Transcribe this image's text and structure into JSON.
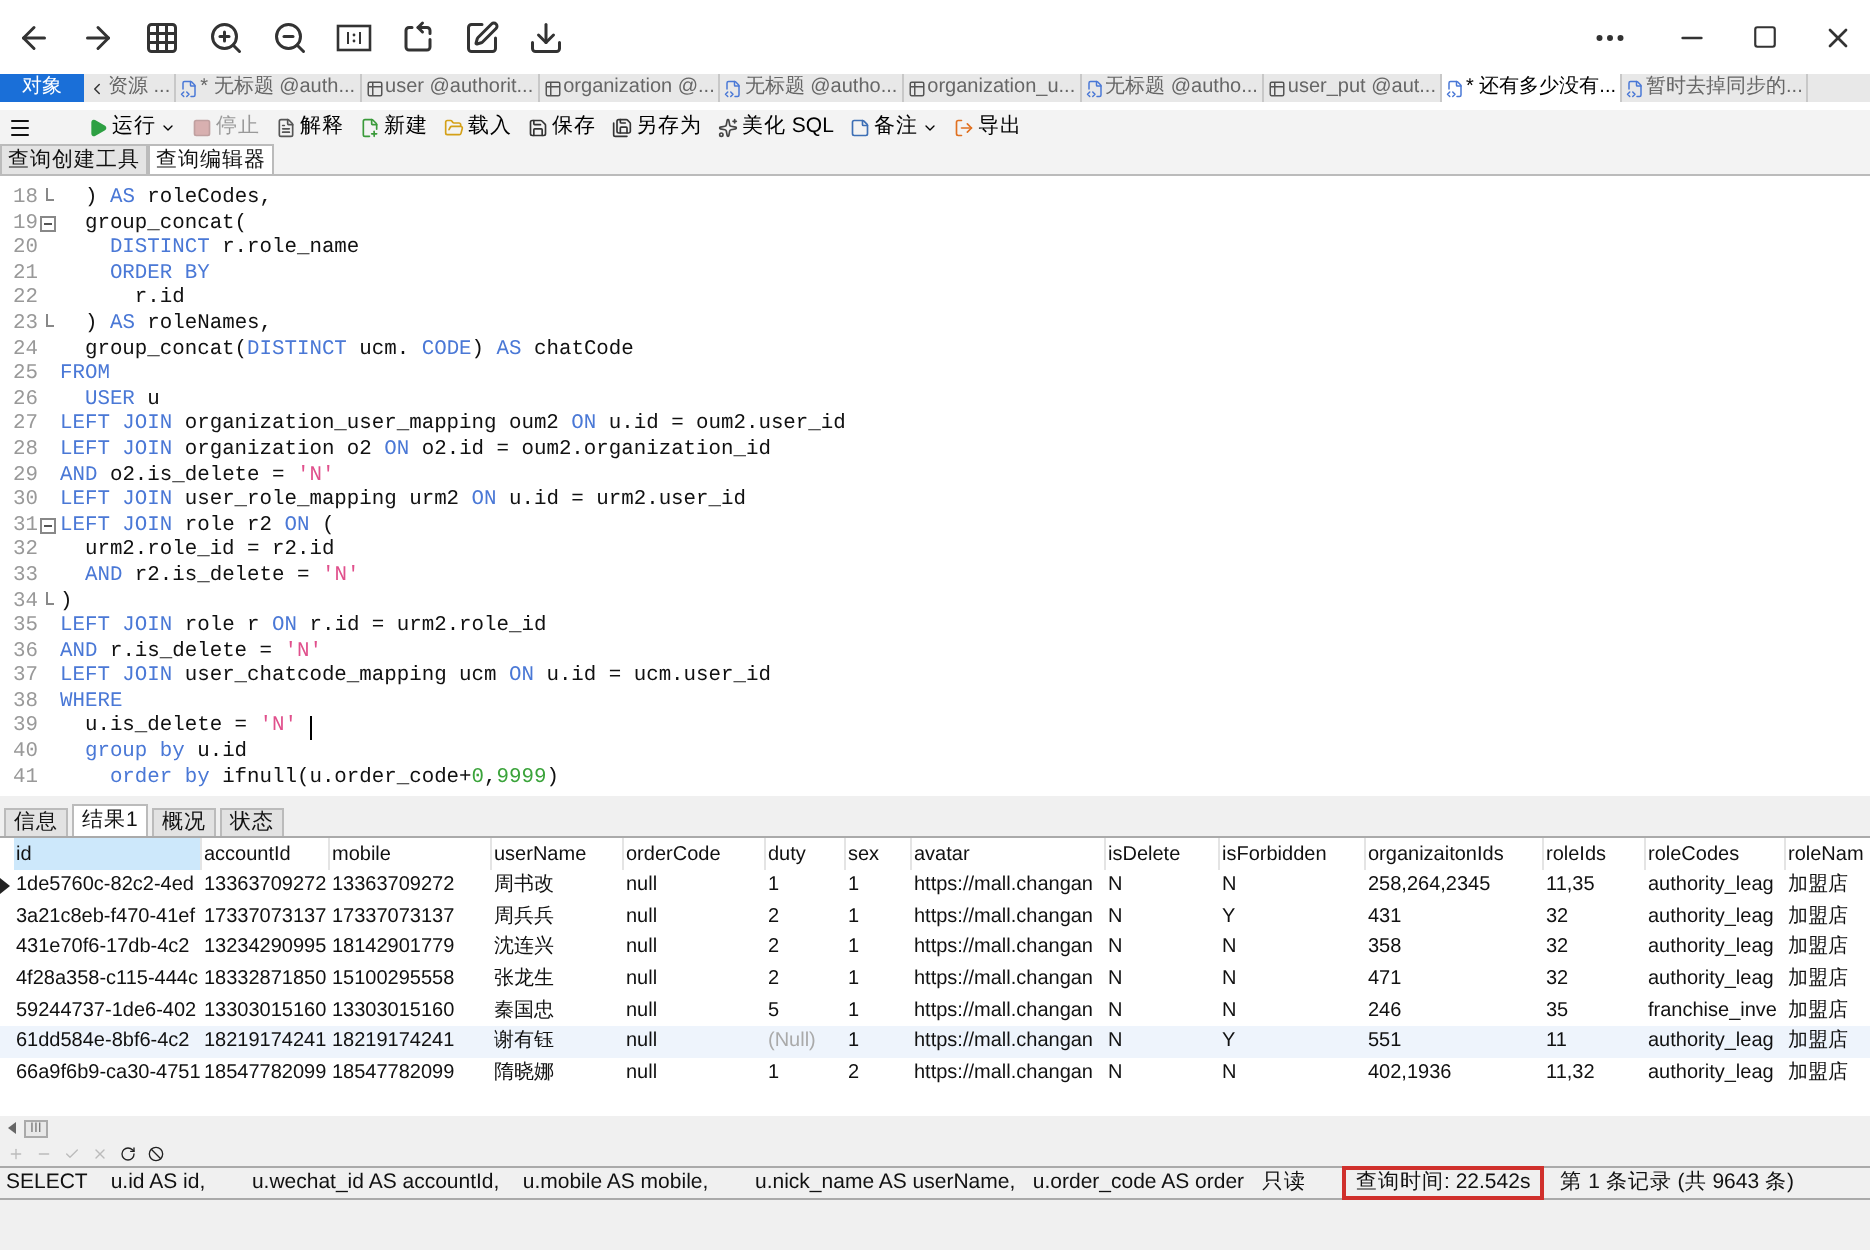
{
  "object_tab": "对象",
  "doc_tabs": [
    {
      "label": "资源 ...",
      "kind": "nav",
      "selected": false
    },
    {
      "label": "* 无标题 @auth...",
      "kind": "query",
      "selected": false
    },
    {
      "label": "user @authorit...",
      "kind": "table",
      "selected": false
    },
    {
      "label": "organization @...",
      "kind": "table",
      "selected": false
    },
    {
      "label": "无标题 @autho...",
      "kind": "query",
      "selected": false
    },
    {
      "label": "organization_u...",
      "kind": "table",
      "selected": false
    },
    {
      "label": "无标题 @autho...",
      "kind": "query",
      "selected": false
    },
    {
      "label": "user_put @aut...",
      "kind": "table",
      "selected": false
    },
    {
      "label": "* 还有多少没有...",
      "kind": "query",
      "selected": true
    },
    {
      "label": "暂时去掉同步的...",
      "kind": "query",
      "selected": false
    }
  ],
  "toolbar": [
    {
      "label": "运行",
      "kind": "run",
      "dropdown": true,
      "disabled": false
    },
    {
      "label": "停止",
      "kind": "stop",
      "dropdown": false,
      "disabled": true
    },
    {
      "label": "解释",
      "kind": "explain",
      "dropdown": false,
      "disabled": false
    },
    {
      "label": "新建",
      "kind": "new",
      "dropdown": false,
      "disabled": false
    },
    {
      "label": "载入",
      "kind": "load",
      "dropdown": false,
      "disabled": false
    },
    {
      "label": "保存",
      "kind": "save",
      "dropdown": false,
      "disabled": false
    },
    {
      "label": "另存为",
      "kind": "saveas",
      "dropdown": false,
      "disabled": false
    },
    {
      "label": "美化 SQL",
      "kind": "beautify",
      "dropdown": false,
      "disabled": false
    },
    {
      "label": "备注",
      "kind": "note",
      "dropdown": true,
      "disabled": false
    },
    {
      "label": "导出",
      "kind": "export",
      "dropdown": false,
      "disabled": false
    }
  ],
  "editor_tabs": [
    {
      "label": "查询创建工具",
      "selected": false
    },
    {
      "label": "查询编辑器",
      "selected": true
    }
  ],
  "code": [
    {
      "num": "18",
      "fold_start": false,
      "fold_end": true,
      "tokens": [
        {
          "text": "  ) ",
          "kind": "plain"
        },
        {
          "text": "AS",
          "kind": "keyword"
        },
        {
          "text": " roleCodes,",
          "kind": "plain"
        }
      ]
    },
    {
      "num": "19",
      "fold_start": true,
      "fold_end": false,
      "tokens": [
        {
          "text": "  group_concat(",
          "kind": "plain"
        }
      ]
    },
    {
      "num": "20",
      "fold_start": false,
      "fold_end": false,
      "tokens": [
        {
          "text": "    DISTINCT",
          "kind": "keyword"
        },
        {
          "text": " r.role_name",
          "kind": "plain"
        }
      ]
    },
    {
      "num": "21",
      "fold_start": false,
      "fold_end": false,
      "tokens": [
        {
          "text": "    ORDER BY",
          "kind": "keyword"
        }
      ]
    },
    {
      "num": "22",
      "fold_start": false,
      "fold_end": false,
      "tokens": [
        {
          "text": "      r.id",
          "kind": "plain"
        }
      ]
    },
    {
      "num": "23",
      "fold_start": false,
      "fold_end": true,
      "tokens": [
        {
          "text": "  ) ",
          "kind": "plain"
        },
        {
          "text": "AS",
          "kind": "keyword"
        },
        {
          "text": " roleNames,",
          "kind": "plain"
        }
      ]
    },
    {
      "num": "24",
      "fold_start": false,
      "fold_end": false,
      "tokens": [
        {
          "text": "  group_concat(",
          "kind": "plain"
        },
        {
          "text": "DISTINCT",
          "kind": "keyword"
        },
        {
          "text": " ucm. ",
          "kind": "plain"
        },
        {
          "text": "CODE",
          "kind": "keyword"
        },
        {
          "text": ") ",
          "kind": "plain"
        },
        {
          "text": "AS",
          "kind": "keyword"
        },
        {
          "text": " chatCode",
          "kind": "plain"
        }
      ]
    },
    {
      "num": "25",
      "fold_start": false,
      "fold_end": false,
      "tokens": [
        {
          "text": "FROM",
          "kind": "keyword"
        }
      ]
    },
    {
      "num": "26",
      "fold_start": false,
      "fold_end": false,
      "tokens": [
        {
          "text": "  USER",
          "kind": "keyword"
        },
        {
          "text": " u",
          "kind": "plain"
        }
      ]
    },
    {
      "num": "27",
      "fold_start": false,
      "fold_end": false,
      "tokens": [
        {
          "text": "LEFT JOIN",
          "kind": "keyword"
        },
        {
          "text": " organization_user_mapping oum2 ",
          "kind": "plain"
        },
        {
          "text": "ON",
          "kind": "keyword"
        },
        {
          "text": " u.id = oum2.user_id",
          "kind": "plain"
        }
      ]
    },
    {
      "num": "28",
      "fold_start": false,
      "fold_end": false,
      "tokens": [
        {
          "text": "LEFT JOIN",
          "kind": "keyword"
        },
        {
          "text": " organization o2 ",
          "kind": "plain"
        },
        {
          "text": "ON",
          "kind": "keyword"
        },
        {
          "text": " o2.id = oum2.organization_id",
          "kind": "plain"
        }
      ]
    },
    {
      "num": "29",
      "fold_start": false,
      "fold_end": false,
      "tokens": [
        {
          "text": "AND",
          "kind": "keyword"
        },
        {
          "text": " o2.is_delete = ",
          "kind": "plain"
        },
        {
          "text": "'N'",
          "kind": "string"
        }
      ]
    },
    {
      "num": "30",
      "fold_start": false,
      "fold_end": false,
      "tokens": [
        {
          "text": "LEFT JOIN",
          "kind": "keyword"
        },
        {
          "text": " user_role_mapping urm2 ",
          "kind": "plain"
        },
        {
          "text": "ON",
          "kind": "keyword"
        },
        {
          "text": " u.id = urm2.user_id",
          "kind": "plain"
        }
      ]
    },
    {
      "num": "31",
      "fold_start": true,
      "fold_end": false,
      "tokens": [
        {
          "text": "LEFT JOIN",
          "kind": "keyword"
        },
        {
          "text": " role r2 ",
          "kind": "plain"
        },
        {
          "text": "ON",
          "kind": "keyword"
        },
        {
          "text": " (",
          "kind": "plain"
        }
      ]
    },
    {
      "num": "32",
      "fold_start": false,
      "fold_end": false,
      "tokens": [
        {
          "text": "  urm2.role_id = r2.id",
          "kind": "plain"
        }
      ]
    },
    {
      "num": "33",
      "fold_start": false,
      "fold_end": false,
      "tokens": [
        {
          "text": "  AND",
          "kind": "keyword"
        },
        {
          "text": " r2.is_delete = ",
          "kind": "plain"
        },
        {
          "text": "'N'",
          "kind": "string"
        }
      ]
    },
    {
      "num": "34",
      "fold_start": false,
      "fold_end": true,
      "tokens": [
        {
          "text": ")",
          "kind": "plain"
        }
      ]
    },
    {
      "num": "35",
      "fold_start": false,
      "fold_end": false,
      "tokens": [
        {
          "text": "LEFT JOIN",
          "kind": "keyword"
        },
        {
          "text": " role r ",
          "kind": "plain"
        },
        {
          "text": "ON",
          "kind": "keyword"
        },
        {
          "text": " r.id = urm2.role_id",
          "kind": "plain"
        }
      ]
    },
    {
      "num": "36",
      "fold_start": false,
      "fold_end": false,
      "tokens": [
        {
          "text": "AND",
          "kind": "keyword"
        },
        {
          "text": " r.is_delete = ",
          "kind": "plain"
        },
        {
          "text": "'N'",
          "kind": "string"
        }
      ]
    },
    {
      "num": "37",
      "fold_start": false,
      "fold_end": false,
      "tokens": [
        {
          "text": "LEFT JOIN",
          "kind": "keyword"
        },
        {
          "text": " user_chatcode_mapping ucm ",
          "kind": "plain"
        },
        {
          "text": "ON",
          "kind": "keyword"
        },
        {
          "text": " u.id = ucm.user_id",
          "kind": "plain"
        }
      ]
    },
    {
      "num": "38",
      "fold_start": false,
      "fold_end": false,
      "tokens": [
        {
          "text": "WHERE",
          "kind": "keyword"
        }
      ]
    },
    {
      "num": "39",
      "fold_start": false,
      "fold_end": false,
      "cursor": true,
      "tokens": [
        {
          "text": "  u.is_delete = ",
          "kind": "plain"
        },
        {
          "text": "'N'",
          "kind": "string"
        }
      ]
    },
    {
      "num": "40",
      "fold_start": false,
      "fold_end": false,
      "tokens": [
        {
          "text": "  group by",
          "kind": "keyword"
        },
        {
          "text": " u.id",
          "kind": "plain"
        }
      ]
    },
    {
      "num": "41",
      "fold_start": false,
      "fold_end": false,
      "tokens": [
        {
          "text": "    order by",
          "kind": "keyword"
        },
        {
          "text": " ifnull(u.order_code+",
          "kind": "plain"
        },
        {
          "text": "0",
          "kind": "number"
        },
        {
          "text": ",",
          "kind": "plain"
        },
        {
          "text": "9999",
          "kind": "number"
        },
        {
          "text": ")",
          "kind": "plain"
        }
      ]
    }
  ],
  "result_tabs": [
    {
      "label": "信息",
      "selected": false
    },
    {
      "label": "结果1",
      "selected": true
    },
    {
      "label": "概况",
      "selected": false
    },
    {
      "label": "状态",
      "selected": false
    }
  ],
  "table": {
    "columns": [
      {
        "label": "id",
        "selected": true
      },
      {
        "label": "accountId",
        "selected": false
      },
      {
        "label": "mobile",
        "selected": false
      },
      {
        "label": "userName",
        "selected": false
      },
      {
        "label": "orderCode",
        "selected": false
      },
      {
        "label": "duty",
        "selected": false
      },
      {
        "label": "sex",
        "selected": false
      },
      {
        "label": "avatar",
        "selected": false
      },
      {
        "label": "isDelete",
        "selected": false
      },
      {
        "label": "isForbidden",
        "selected": false
      },
      {
        "label": "organizaitonIds",
        "selected": false
      },
      {
        "label": "roleIds",
        "selected": false
      },
      {
        "label": "roleCodes",
        "selected": false
      },
      {
        "label": "roleNam",
        "selected": false
      }
    ],
    "rows": [
      {
        "current": true,
        "hover": false,
        "cells": [
          "1de5760c-82c2-4ed",
          "13363709272",
          "13363709272",
          "周书改",
          "null",
          "1",
          "1",
          "https://mall.changan",
          "N",
          "N",
          "258,264,2345",
          "11,35",
          "authority_leag",
          "加盟店"
        ]
      },
      {
        "current": false,
        "hover": false,
        "cells": [
          "3a21c8eb-f470-41ef",
          "17337073137",
          "17337073137",
          "周兵兵",
          "null",
          "2",
          "1",
          "https://mall.changan",
          "N",
          "Y",
          "431",
          "32",
          "authority_leag",
          "加盟店"
        ]
      },
      {
        "current": false,
        "hover": false,
        "cells": [
          "431e70f6-17db-4c2",
          "13234290995",
          "18142901779",
          "沈连兴",
          "null",
          "2",
          "1",
          "https://mall.changan",
          "N",
          "N",
          "358",
          "32",
          "authority_leag",
          "加盟店"
        ]
      },
      {
        "current": false,
        "hover": false,
        "cells": [
          "4f28a358-c115-444c",
          "18332871850",
          "15100295558",
          "张龙生",
          "null",
          "2",
          "1",
          "https://mall.changan",
          "N",
          "N",
          "471",
          "32",
          "authority_leag",
          "加盟店"
        ]
      },
      {
        "current": false,
        "hover": false,
        "cells": [
          "59244737-1de6-402",
          "13303015160",
          "13303015160",
          "秦国忠",
          "null",
          "5",
          "1",
          "https://mall.changan",
          "N",
          "N",
          "246",
          "35",
          "franchise_inve",
          "加盟店"
        ]
      },
      {
        "current": false,
        "hover": true,
        "cells": [
          "61dd584e-8bf6-4c2",
          "18219174241",
          "18219174241",
          "谢有钰",
          "null",
          {
            "text": "(Null)",
            "kind": "null"
          },
          "1",
          "https://mall.changan",
          "N",
          "Y",
          "551",
          "11",
          "authority_leag",
          "加盟店"
        ]
      },
      {
        "current": false,
        "hover": false,
        "cells": [
          "66a9f6b9-ca30-4751",
          "18547782099",
          "18547782099",
          "隋晓娜",
          "null",
          "1",
          "2",
          "https://mall.changan",
          "N",
          "N",
          "402,1936",
          "11,32",
          "authority_leag",
          "加盟店"
        ]
      }
    ]
  },
  "scroll_thumb": "III",
  "status_bar": {
    "sql": "SELECT    u.id AS id,        u.wechat_id AS accountId,    u.mobile AS mobile,        u.nick_name AS userName,   u.order_code AS order",
    "mode": "只读",
    "query_time": "查询时间: 22.542s",
    "query_time_highlighted": true,
    "record": "第 1 条记录 (共 9643 条)"
  }
}
